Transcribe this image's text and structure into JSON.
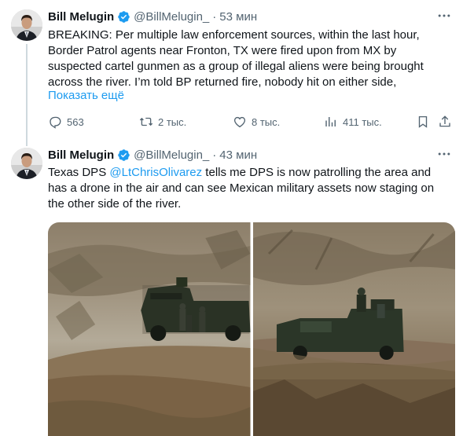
{
  "tweets": [
    {
      "name": "Bill Melugin",
      "handle": "@BillMelugin_",
      "separator": "·",
      "time": "53 мин",
      "text": "BREAKING: Per multiple law enforcement sources, within the last hour, Border Patrol agents near Fronton, TX were fired upon from MX by suspected cartel gunmen as a group of illegal aliens were being brought across the river. I’m told BP returned fire, nobody hit on either side,",
      "show_more": "Показать ещё",
      "replies": "563",
      "retweets": "2 тыс.",
      "likes": "8 тыс.",
      "views": "411 тыс."
    },
    {
      "name": "Bill Melugin",
      "handle": "@BillMelugin_",
      "separator": "·",
      "time": "43 мин",
      "text_before": "Texas DPS ",
      "mention": "@LtChrisOlivarez",
      "text_after": " tells me DPS is now patrolling the area and has a drone in the air and can see Mexican military assets now staging on the other side of the river."
    }
  ],
  "colors": {
    "accent": "#1d9bf0",
    "verified": "#1d9bf0",
    "secondary_text": "#536471",
    "thread_line": "#cfd9de"
  },
  "icons": {
    "verified": "verified-badge-icon",
    "more": "more-dots-icon",
    "reply": "reply-icon",
    "retweet": "retweet-icon",
    "like": "heart-icon",
    "views": "views-icon",
    "bookmark": "bookmark-icon",
    "share": "share-icon"
  }
}
